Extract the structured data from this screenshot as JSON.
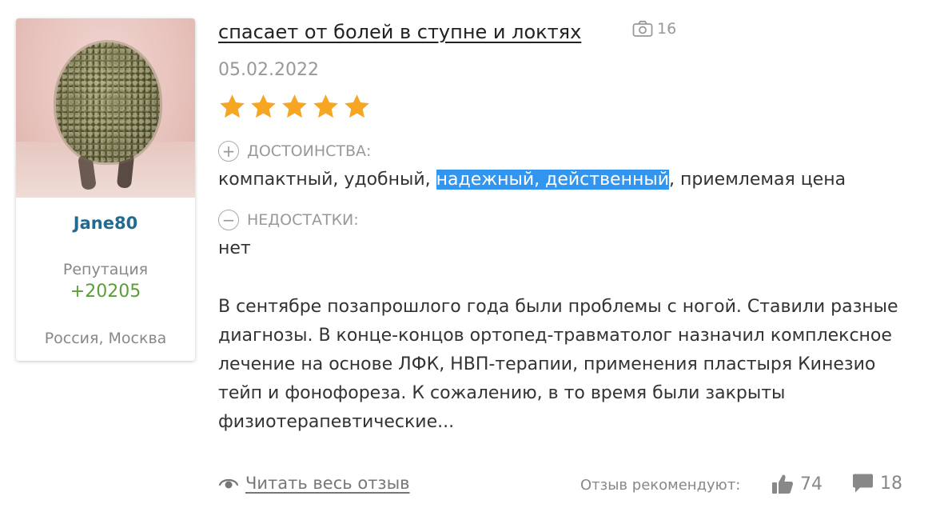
{
  "author": {
    "name": "Jane80",
    "reputation_label": "Репутация",
    "reputation_value": "+20205",
    "location": "Россия, Москва"
  },
  "review": {
    "title": "спасает от болей в ступне и локтях",
    "photo_count": "16",
    "date": "05.02.2022",
    "rating": 5,
    "rating_max": 5,
    "pros_label": "ДОСТОИНСТВА:",
    "pros_before": "компактный, удобный, ",
    "pros_highlight": "надежный, действенный",
    "pros_after": ", приемлемая цена",
    "cons_label": "НЕДОСТАТКИ:",
    "cons_text": "нет",
    "body_lines": [
      "В сентябре позапрошлого года были проблемы с ногой. Ставили разные",
      "диагнозы. В конце-концов ортопед-травматолог назначил комплексное",
      "лечение на основе ЛФК, НВП-терапии, применения пластыря Кинезио",
      "тейп и фонофореза. К сожалению, в то время были закрыты",
      "физиотерапевтические..."
    ]
  },
  "footer": {
    "read_more": "Читать весь отзыв",
    "recommend_label": "Отзыв рекомендуют:",
    "likes": "74",
    "comments": "18"
  },
  "colors": {
    "star": "#f6a623",
    "author_name": "#226b8e",
    "reputation": "#5a9e3a",
    "highlight": "#3296f0"
  },
  "icons": [
    "camera-icon",
    "star-icon",
    "plus-circle-icon",
    "minus-circle-icon",
    "eye-icon",
    "thumbs-up-icon",
    "comment-icon"
  ]
}
